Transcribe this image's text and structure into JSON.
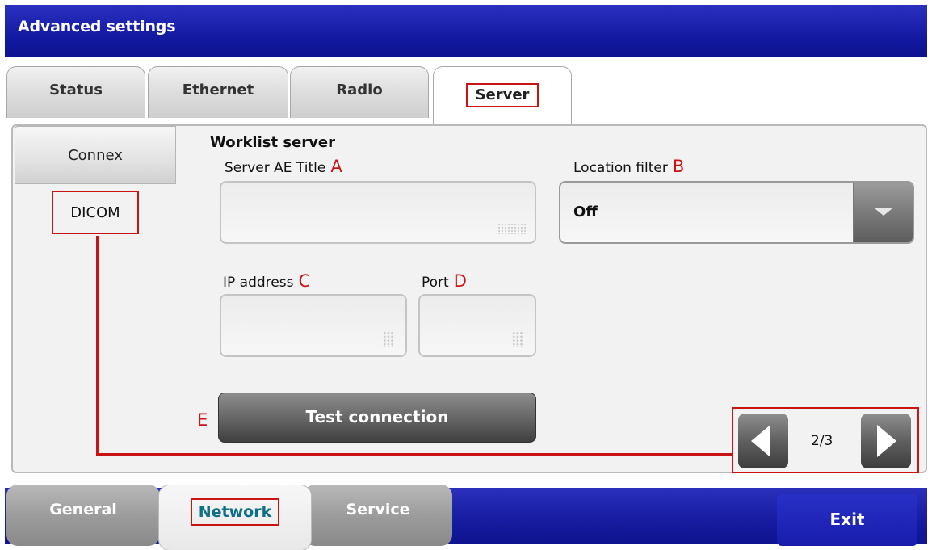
{
  "window": {
    "title": "Advanced settings"
  },
  "top_tabs": [
    {
      "label": "Status"
    },
    {
      "label": "Ethernet"
    },
    {
      "label": "Radio"
    },
    {
      "label": "Server",
      "active": true
    }
  ],
  "side_tabs": [
    {
      "label": "Connex"
    },
    {
      "label": "DICOM",
      "active": true
    }
  ],
  "worklist": {
    "section_title": "Worklist server",
    "server_ae_title": {
      "label": "Server AE Title",
      "marker": "A",
      "value": ""
    },
    "location_filter": {
      "label": "Location filter",
      "marker": "B",
      "value": "Off"
    },
    "ip_address": {
      "label": "IP address",
      "marker": "C",
      "value": ""
    },
    "port": {
      "label": "Port",
      "marker": "D",
      "value": ""
    },
    "test_button": {
      "label": "Test connection",
      "marker": "E"
    }
  },
  "pager": {
    "text": "2/3",
    "current": 2,
    "total": 3
  },
  "bottom_tabs": [
    {
      "label": "General"
    },
    {
      "label": "Network",
      "active": true
    },
    {
      "label": "Service"
    }
  ],
  "exit_label": "Exit",
  "colors": {
    "title_bar": "#141aa2",
    "annotation_red": "#c81414",
    "active_bottom_tab_text": "#0e6f86"
  },
  "icons": [
    "keyboard-icon",
    "keypad-icon",
    "dropdown-arrow-icon",
    "prev-arrow-icon",
    "next-arrow-icon"
  ]
}
